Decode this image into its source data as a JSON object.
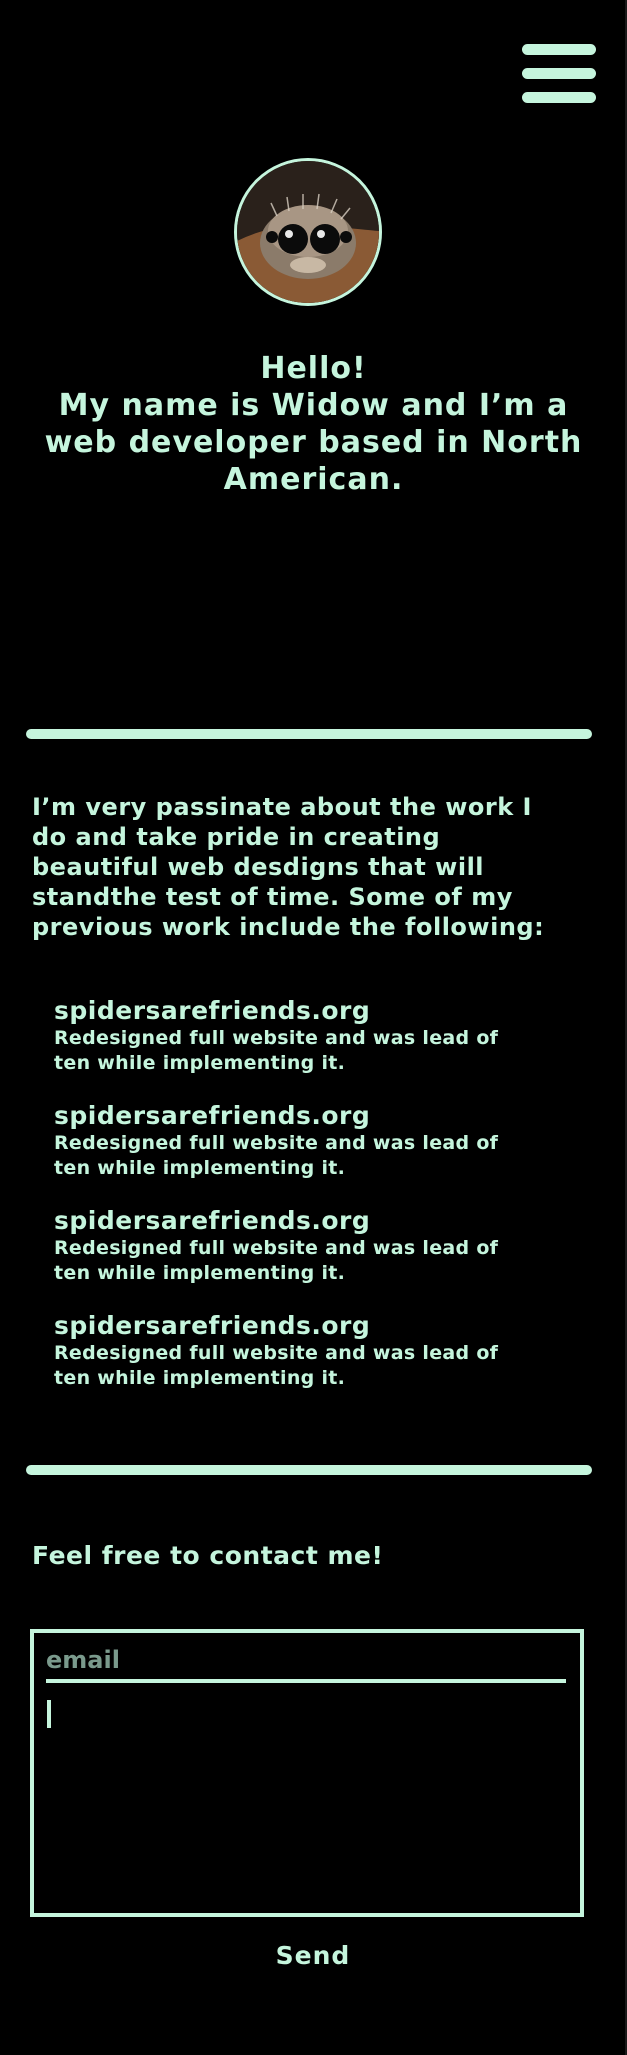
{
  "theme": {
    "background": "#000000",
    "accent": "#c5f5dd",
    "placeholder": "#7a9a8c"
  },
  "header": {
    "menu_icon": "hamburger-menu-icon"
  },
  "profile": {
    "avatar": "jumping-spider-avatar"
  },
  "hero": {
    "line1": "Hello!",
    "line2": "My name is Widow and I’m a",
    "line3": "web developer based in North",
    "line4": "American."
  },
  "about": {
    "text": "I’m very passinate about the work I do and take pride in creating beautiful web desdigns that will standthe test of time. Some of my previous work include the following:"
  },
  "projects": [
    {
      "title": "spidersarefriends.org",
      "description": "Redesigned full website and was lead of ten while implementing it."
    },
    {
      "title": "spidersarefriends.org",
      "description": "Redesigned full website and was lead of ten while implementing it."
    },
    {
      "title": "spidersarefriends.org",
      "description": "Redesigned full website and was lead of ten while implementing it."
    },
    {
      "title": "spidersarefriends.org",
      "description": "Redesigned full website and was lead of ten while implementing it."
    }
  ],
  "contact": {
    "heading": "Feel free to contact me!",
    "email_placeholder": "email",
    "email_value": "",
    "message_value": "",
    "send_label": "Send"
  }
}
